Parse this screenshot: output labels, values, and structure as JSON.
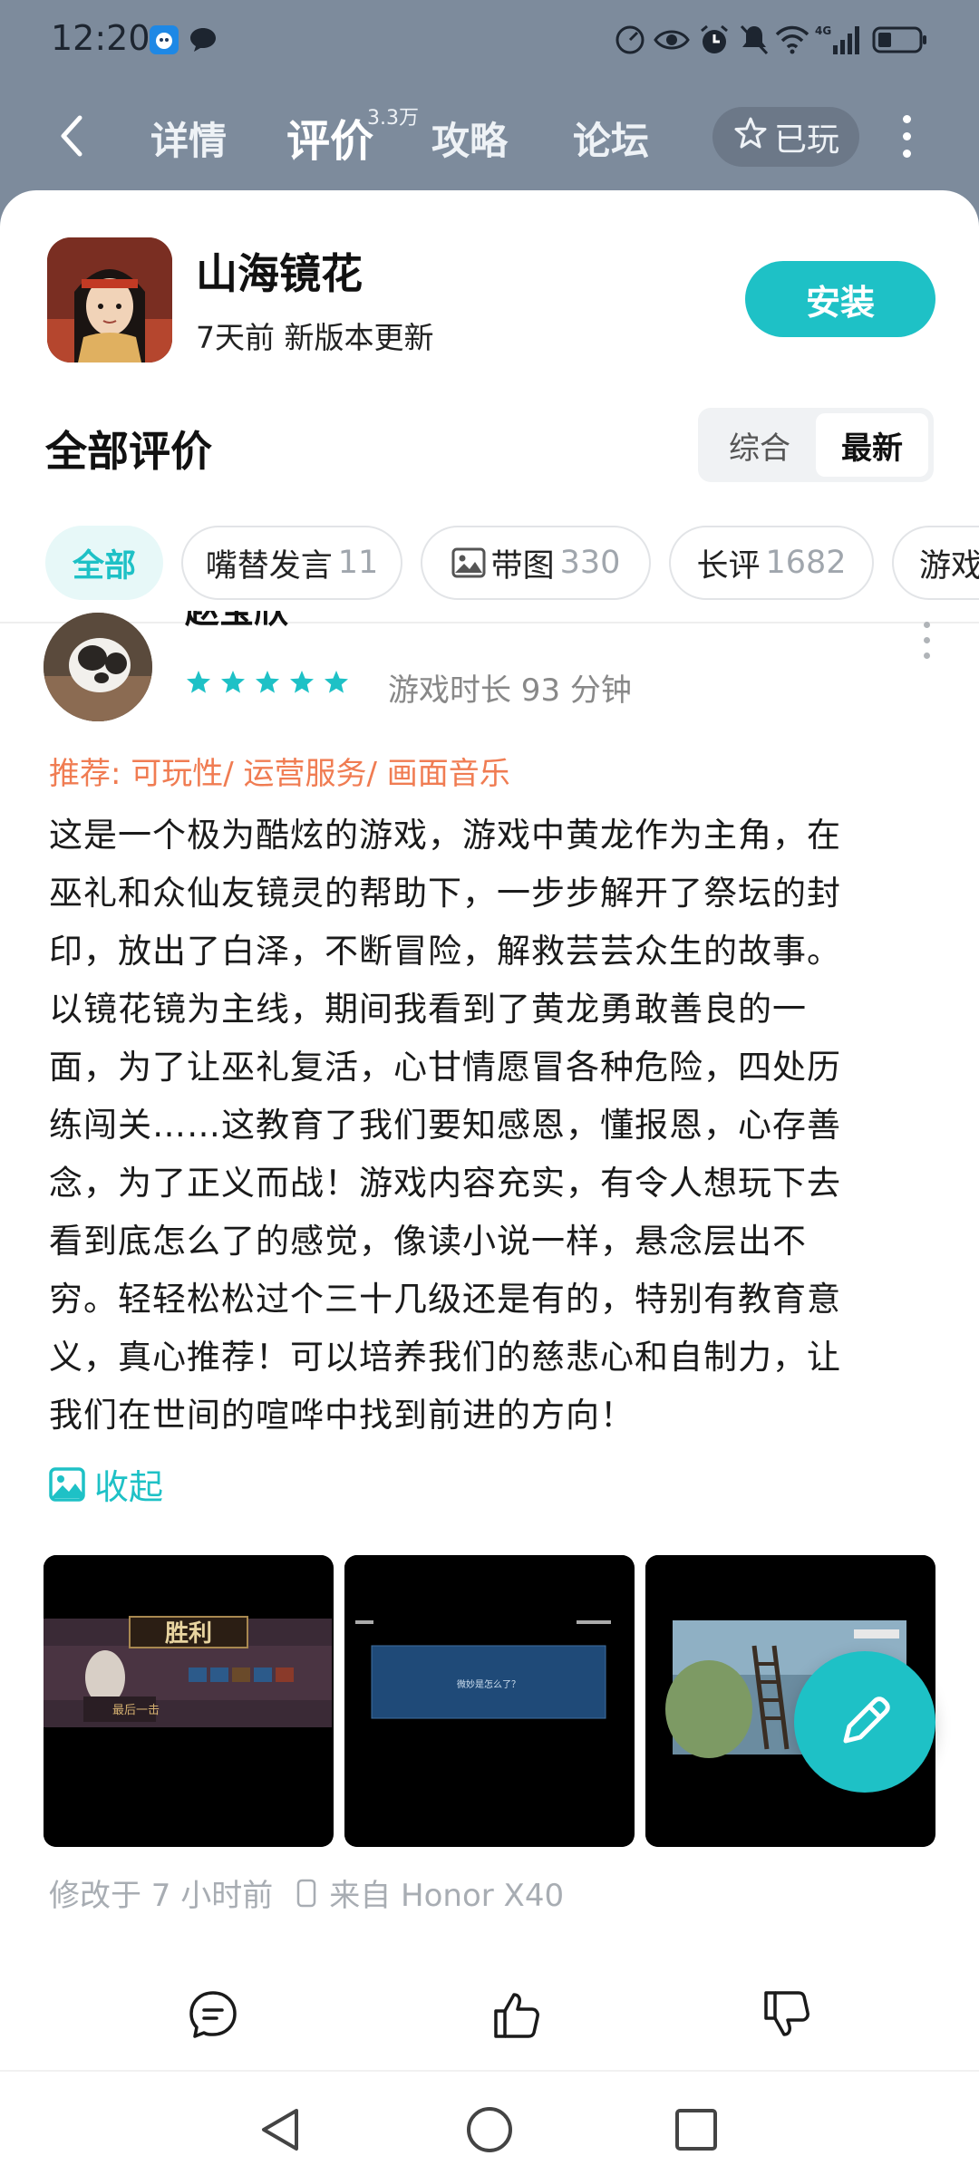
{
  "status_bar": {
    "time": "12:20",
    "network": "4G"
  },
  "nav": {
    "back": "back",
    "tabs": [
      {
        "label": "详情"
      },
      {
        "label": "评价",
        "badge": "3.3万"
      },
      {
        "label": "攻略"
      },
      {
        "label": "论坛"
      }
    ],
    "played_label": "已玩"
  },
  "app": {
    "name": "山海镜花",
    "update_info": "7天前 新版本更新",
    "install_label": "安装"
  },
  "reviews_header": {
    "title": "全部评价",
    "sort_options": [
      "综合",
      "最新"
    ],
    "sort_selected": "最新"
  },
  "filters": [
    {
      "label": "全部",
      "count": ""
    },
    {
      "label": "嘴替发言",
      "count": "11"
    },
    {
      "label": "带图",
      "count": "330"
    },
    {
      "label": "长评",
      "count": "1682"
    },
    {
      "label": "游戏",
      "count": ""
    }
  ],
  "review": {
    "reviewer_name": "赵宝欣",
    "rating": 5,
    "playtime": "游戏时长 93 分钟",
    "tags": "推荐: 可玩性/ 运营服务/ 画面音乐",
    "lines": [
      "这是一个极为酷炫的游戏，游戏中黄龙作为主角，在",
      "巫礼和众仙友镜灵的帮助下，一步步解开了祭坛的封",
      "印，放出了白泽，不断冒险，解救芸芸众生的故事。",
      "以镜花镜为主线，期间我看到了黄龙勇敢善良的一",
      "面，为了让巫礼复活，心甘情愿冒各种危险，四处历",
      "练闯关……这教育了我们要知感恩，懂报恩，心存善",
      "念，为了正义而战！游戏内容充实，有令人想玩下去",
      "看到底怎么了的感觉，像读小说一样，悬念层出不",
      "穷。轻轻松松过个三十几级还是有的，特别有教育意",
      "义，真心推荐！可以培养我们的慈悲心和自制力，让",
      "我们在世间的喧哗中找到前进的方向！"
    ],
    "collapse_label": "收起",
    "screenshots": [
      {
        "caption": "胜利",
        "sub": "最后一击"
      },
      {
        "caption": "微妙是怎么了？"
      },
      {
        "caption": ""
      }
    ],
    "modified": "修改于 7 小时前",
    "device": "来自 Honor X40"
  },
  "colors": {
    "accent": "#1ec1c6",
    "tag": "#f07c52",
    "header_bg": "#7d8b9c",
    "star": "#1ec1c6"
  }
}
